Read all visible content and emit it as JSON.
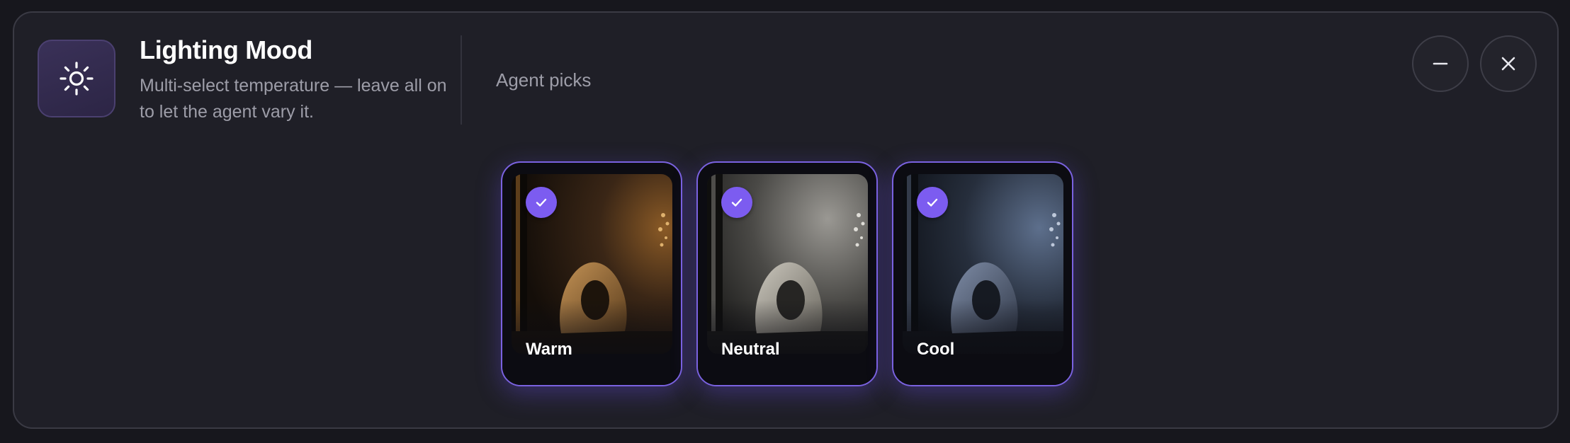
{
  "header": {
    "title": "Lighting Mood",
    "subtitle": "Multi-select temperature — leave all on to let the agent vary it.",
    "icon": "sun-icon",
    "side_label": "Agent picks"
  },
  "window_controls": {
    "minimize_icon": "minus-icon",
    "close_icon": "close-icon"
  },
  "options": [
    {
      "label": "Warm",
      "selected": true,
      "tint": "#b5834a"
    },
    {
      "label": "Neutral",
      "selected": true,
      "tint": "#bdbab2"
    },
    {
      "label": "Cool",
      "selected": true,
      "tint": "#6d82a6"
    }
  ],
  "colors": {
    "accent": "#7c5cf0",
    "card_border": "#7a62e0",
    "panel_background": "#1f1f27",
    "muted_text": "#9d9da8"
  }
}
